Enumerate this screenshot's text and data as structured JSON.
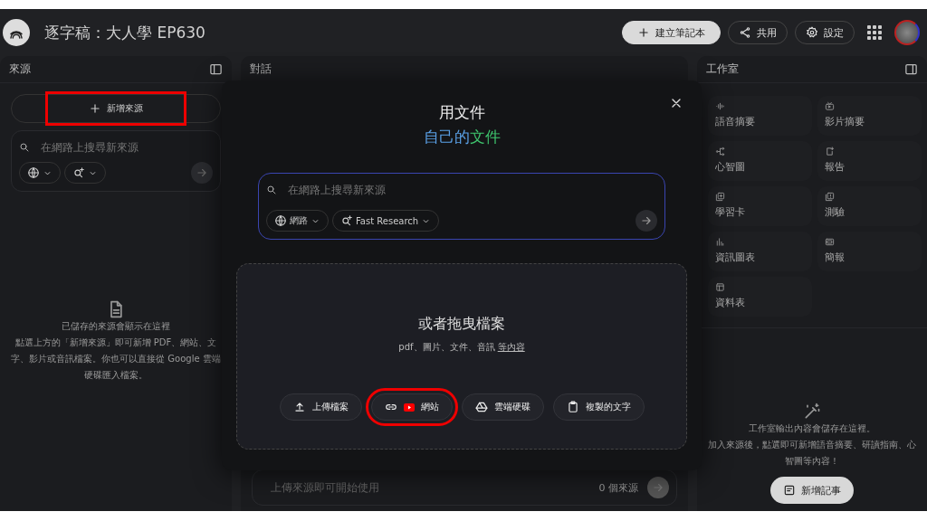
{
  "header": {
    "title": "逐字稿：大人學 EP630",
    "buttons": [
      {
        "label": "建立筆記本",
        "kind": "create"
      },
      {
        "label": "共用",
        "kind": "share"
      },
      {
        "label": "設定",
        "kind": "settings"
      }
    ]
  },
  "sources_panel": {
    "title": "來源",
    "add_button": {
      "label": "新增來源",
      "highlighted": true
    },
    "search": {
      "placeholder": "在網路上搜尋新來源"
    },
    "empty_title": "已儲存的來源會顯示在這裡",
    "empty_text": "點選上方的「新增來源」即可新增 PDF、網站、文字、影片或音訊檔案。你也可以直接從 Google 雲端硬碟匯入檔案。"
  },
  "chat_panel": {
    "title": "對話",
    "input": {
      "placeholder": "上傳來源即可開始使用"
    },
    "source_count": "0 個來源"
  },
  "studio_panel": {
    "title": "工作室",
    "tools": [
      {
        "label": "語音摘要",
        "kind": "audio"
      },
      {
        "label": "影片摘要",
        "kind": "video"
      },
      {
        "label": "心智圖",
        "kind": "mindmap"
      },
      {
        "label": "報告",
        "kind": "report"
      },
      {
        "label": "學習卡",
        "kind": "flashcards"
      },
      {
        "label": "測驗",
        "kind": "quiz"
      },
      {
        "label": "資訊圖表",
        "kind": "infographic"
      },
      {
        "label": "簡報",
        "kind": "slides"
      },
      {
        "label": "資料表",
        "kind": "table"
      }
    ],
    "empty_title": "工作室輸出內容會儲存在這裡。",
    "empty_text": "加入來源後，點選即可新增語音摘要、研讀指南、心智圖等內容！",
    "note_button": "新增記事"
  },
  "dialog": {
    "title": "用文件",
    "subtitle_a": "自己的",
    "subtitle_b": "文件",
    "search": {
      "placeholder": "在網路上搜尋新來源",
      "chips": [
        {
          "label": "網路",
          "kind": "web"
        },
        {
          "label": "Fast Research",
          "kind": "research"
        }
      ]
    },
    "drop_title": "或者拖曳檔案",
    "drop_text": "pdf、圖片、文件、音訊",
    "drop_link": "等內容",
    "actions": [
      {
        "label": "上傳檔案",
        "kind": "upload",
        "highlighted": false
      },
      {
        "label": "網站",
        "kind": "website",
        "highlighted": true
      },
      {
        "label": "雲端硬碟",
        "kind": "drive",
        "highlighted": false
      },
      {
        "label": "複製的文字",
        "kind": "paste",
        "highlighted": false
      }
    ]
  }
}
